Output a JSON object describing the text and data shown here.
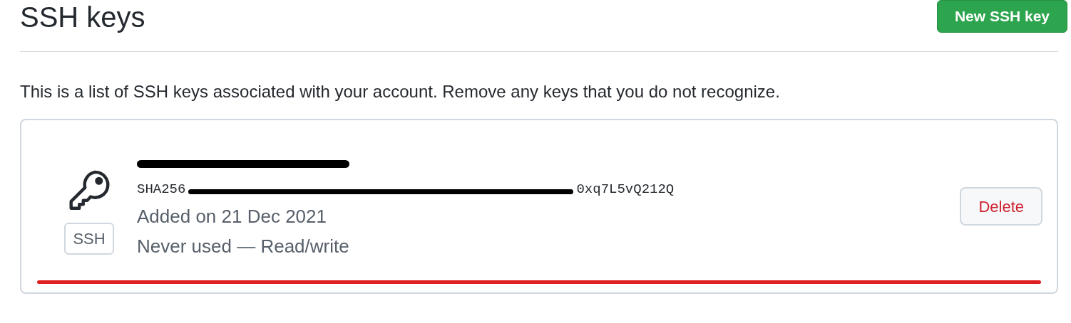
{
  "header": {
    "title": "SSH keys",
    "new_button": "New SSH key"
  },
  "description": "This is a list of SSH keys associated with your account. Remove any keys that you do not recognize.",
  "keys": [
    {
      "title_redacted": true,
      "fingerprint_prefix": "SHA256",
      "fingerprint_suffix": "0xq7L5vQ212Q",
      "badge": "SSH",
      "added": "Added on 21 Dec 2021",
      "usage": "Never used — Read/write",
      "delete_button": "Delete",
      "underlined": true
    }
  ]
}
